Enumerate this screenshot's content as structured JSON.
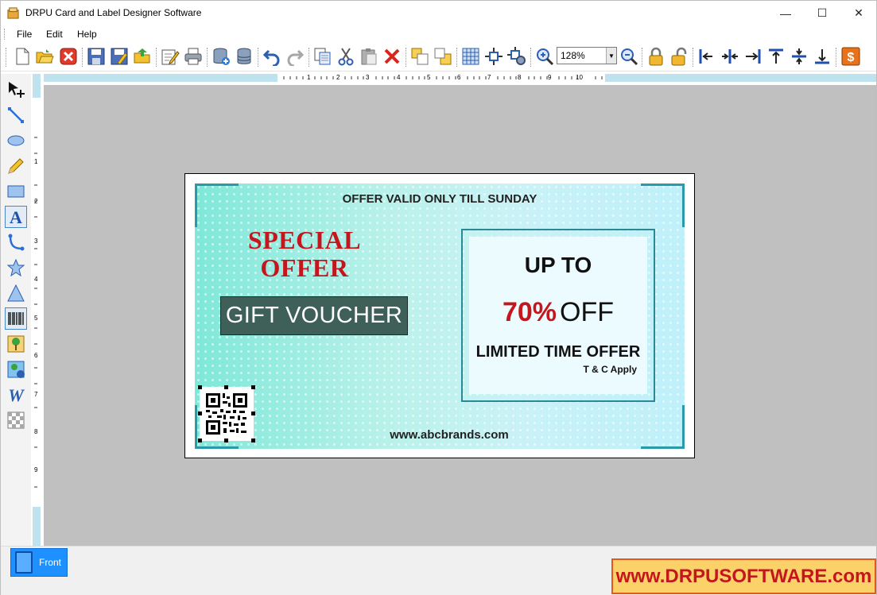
{
  "window": {
    "title": "DRPU Card and Label Designer Software",
    "controls": {
      "minimize": "—",
      "maximize": "☐",
      "close": "✕"
    }
  },
  "menu": [
    "File",
    "Edit",
    "Help"
  ],
  "toolbar": {
    "zoom_value": "128%"
  },
  "hruler_labels": [
    "1",
    "2",
    "3",
    "4",
    "5",
    "6",
    "7",
    "8",
    "9",
    "10"
  ],
  "vruler_labels": [
    "1",
    "2",
    "3",
    "4",
    "5",
    "6",
    "7",
    "8",
    "9"
  ],
  "card": {
    "offer_valid": "OFFER VALID ONLY TILL SUNDAY",
    "special_line1": "SPECIAL",
    "special_line2": "OFFER",
    "gift_voucher": "GIFT VOUCHER",
    "up_to": "UP TO",
    "percent": "70%",
    "off": "OFF",
    "limited": "LIMITED TIME OFFER",
    "tnc": "T & C Apply",
    "website": "www.abcbrands.com"
  },
  "tabs": {
    "front": "Front"
  },
  "brand": "www.DRPUSOFTWARE.com",
  "colors": {
    "accent_red": "#c4161c",
    "teal_frame": "#2a8996",
    "tab_blue": "#1e90ff",
    "brand_orange": "#e35b12"
  }
}
